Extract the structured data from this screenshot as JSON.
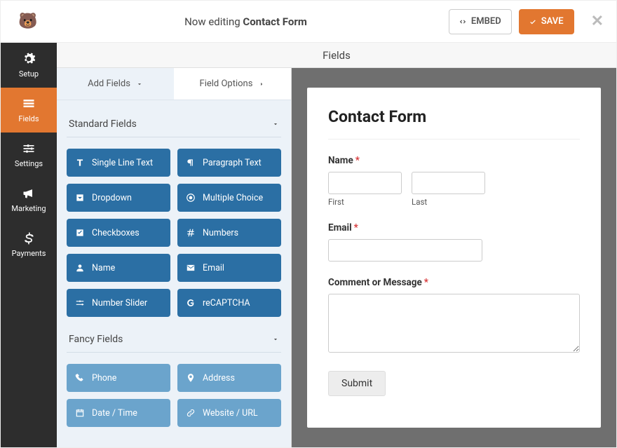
{
  "topbar": {
    "editing_prefix": "Now editing ",
    "form_name": "Contact Form",
    "embed_label": "EMBED",
    "save_label": "SAVE"
  },
  "sidebar": {
    "items": [
      {
        "label": "Setup"
      },
      {
        "label": "Fields"
      },
      {
        "label": "Settings"
      },
      {
        "label": "Marketing"
      },
      {
        "label": "Payments"
      }
    ]
  },
  "main": {
    "header": "Fields",
    "tabs": {
      "add": "Add Fields",
      "options": "Field Options"
    },
    "groups": [
      {
        "title": "Standard Fields",
        "tiles": [
          {
            "label": "Single Line Text",
            "icon": "text"
          },
          {
            "label": "Paragraph Text",
            "icon": "paragraph"
          },
          {
            "label": "Dropdown",
            "icon": "caret"
          },
          {
            "label": "Multiple Choice",
            "icon": "dot"
          },
          {
            "label": "Checkboxes",
            "icon": "check"
          },
          {
            "label": "Numbers",
            "icon": "hash"
          },
          {
            "label": "Name",
            "icon": "user"
          },
          {
            "label": "Email",
            "icon": "mail"
          },
          {
            "label": "Number Slider",
            "icon": "sliders"
          },
          {
            "label": "reCAPTCHA",
            "icon": "g"
          }
        ]
      },
      {
        "title": "Fancy Fields",
        "light": true,
        "tiles": [
          {
            "label": "Phone",
            "icon": "phone"
          },
          {
            "label": "Address",
            "icon": "pin"
          },
          {
            "label": "Date / Time",
            "icon": "cal"
          },
          {
            "label": "Website / URL",
            "icon": "link"
          }
        ]
      }
    ]
  },
  "preview": {
    "title": "Contact Form",
    "name_label": "Name",
    "first_sub": "First",
    "last_sub": "Last",
    "email_label": "Email",
    "comment_label": "Comment or Message",
    "submit_label": "Submit"
  }
}
